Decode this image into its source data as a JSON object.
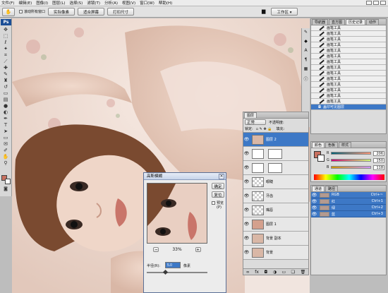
{
  "menubar": {
    "items": [
      "文件(F)",
      "编辑(E)",
      "图像(I)",
      "图层(L)",
      "选择(S)",
      "滤镜(T)",
      "分析(A)",
      "视图(V)",
      "窗口(W)",
      "帮助(H)"
    ]
  },
  "options": {
    "scroll_all_label": "滚动所有窗口",
    "actual_pixels_label": "实际像素",
    "fit_screen_label": "适合屏幕",
    "print_size_label": "打印尺寸",
    "workspace_label": "工作区 ▾"
  },
  "history": {
    "tabs": [
      "导航器",
      "直方图",
      "历史记录",
      "动作"
    ],
    "item_label": "画笔工具",
    "item_count": 14,
    "last_label": "盖印可见图层"
  },
  "layers": {
    "tab": "图层",
    "blend_mode": "正常",
    "opacity_label": "不透明度:",
    "lock_label": "锁定:",
    "fill_label": "填充:",
    "rows": [
      {
        "name": "图层 2",
        "selected": true,
        "kind": "photo"
      },
      {
        "name": "",
        "selected": false,
        "kind": "curves-mask"
      },
      {
        "name": "",
        "selected": false,
        "kind": "curves-white"
      },
      {
        "name": "眼睫",
        "selected": false,
        "kind": "empty"
      },
      {
        "name": "牙齿",
        "selected": false,
        "kind": "empty"
      },
      {
        "name": "嘴唇",
        "selected": false,
        "kind": "empty"
      },
      {
        "name": "图层 1",
        "selected": false,
        "kind": "skin"
      },
      {
        "name": "背景 副本",
        "selected": false,
        "kind": "photo"
      },
      {
        "name": "背景",
        "selected": false,
        "kind": "photo"
      }
    ]
  },
  "color_panel": {
    "tabs": [
      "颜色",
      "色板",
      "样式"
    ],
    "rows": [
      {
        "label": "R",
        "value": "206"
      },
      {
        "label": "G",
        "value": "150"
      },
      {
        "label": "B",
        "value": "118"
      }
    ],
    "foreground": "#c87060",
    "background": "#ffffff"
  },
  "channels": {
    "tabs": [
      "通道",
      "路径"
    ],
    "rows": [
      {
        "name": "RGB",
        "shortcut": "Ctrl+~"
      },
      {
        "name": "红",
        "shortcut": "Ctrl+1"
      },
      {
        "name": "绿",
        "shortcut": "Ctrl+2"
      },
      {
        "name": "蓝",
        "shortcut": "Ctrl+3"
      }
    ]
  },
  "dialog": {
    "title": "高斯模糊",
    "ok_label": "确定",
    "reset_label": "复位",
    "preview_label": "预览(P)",
    "zoom_value": "33%",
    "radius_label": "半径(R):",
    "radius_value": "5.0",
    "unit_label": "像素",
    "minus_label": "−",
    "plus_label": "+"
  },
  "toolbox": {
    "logo": "Ps"
  },
  "colors": {
    "accent": "#3d78c6",
    "canvas_skin": "#e8d2c5",
    "hair": "#7a4a30"
  }
}
